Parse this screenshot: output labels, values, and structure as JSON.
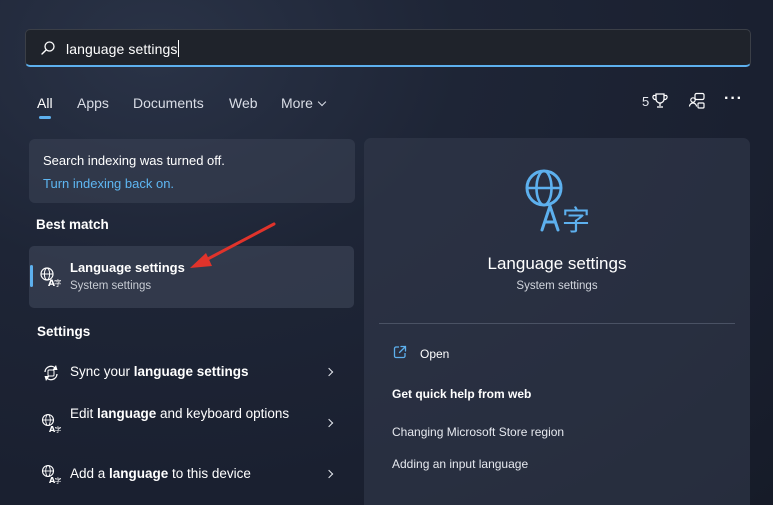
{
  "search": {
    "query": "language settings"
  },
  "tabs": [
    {
      "label": "All"
    },
    {
      "label": "Apps"
    },
    {
      "label": "Documents"
    },
    {
      "label": "Web"
    },
    {
      "label": "More"
    }
  ],
  "toolbar": {
    "points": "5"
  },
  "notice": {
    "text": "Search indexing was turned off.",
    "link": "Turn indexing back on."
  },
  "best_match": {
    "heading": "Best match",
    "title": "Language settings",
    "subtitle": "System settings"
  },
  "settings": {
    "heading": "Settings",
    "items": [
      {
        "pre": "Sync your ",
        "bold": "language settings",
        "post": ""
      },
      {
        "pre": "Edit ",
        "bold": "language",
        "post": " and keyboard options"
      },
      {
        "pre": "Add a ",
        "bold": "language",
        "post": " to this device"
      }
    ]
  },
  "preview": {
    "title": "Language settings",
    "subtitle": "System settings",
    "open_label": "Open",
    "help_title": "Get quick help from web",
    "help_links": [
      "Changing Microsoft Store region",
      "Adding an input language"
    ]
  },
  "colors": {
    "accent": "#5db0ee",
    "link": "#5eb6f2",
    "arrow": "#e0332b"
  }
}
